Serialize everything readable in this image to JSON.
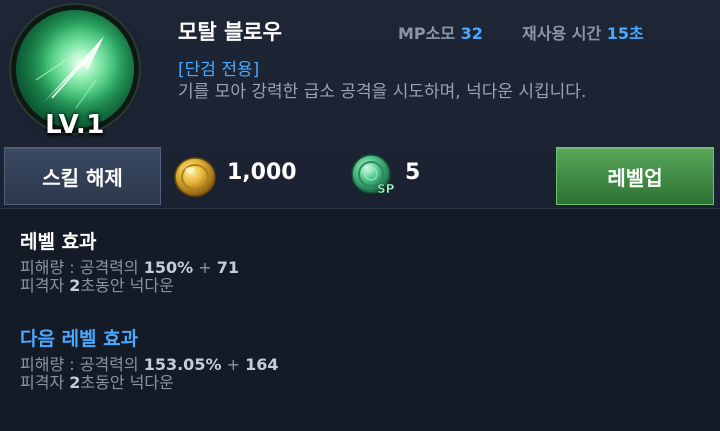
{
  "skill": {
    "name": "모탈 블로우",
    "level_label": "LV.1",
    "icon": "blade-slash-icon",
    "mp_label": "MP소모",
    "mp_value": "32",
    "cooldown_label": "재사용 시간",
    "cooldown_value": "15초",
    "tag": "[단검 전용]",
    "description": "기를 모아 강력한 급소 공격을 시도하며, 넉다운 시킵니다."
  },
  "actions": {
    "release_label": "스킬 해제",
    "gold_icon": "gold-coin-icon",
    "gold_amount": "1,000",
    "sp_icon": "sp-orb-icon",
    "sp_amount": "5",
    "levelup_label": "레벨업"
  },
  "current_effect": {
    "title": "레벨 효과",
    "damage_prefix": "피해량 : 공격력의 ",
    "damage_percent": "150%",
    "damage_plus": " + ",
    "damage_flat": "71",
    "kd_prefix": "피격자 ",
    "kd_value": "2",
    "kd_suffix": "초동안 넉다운"
  },
  "next_effect": {
    "title": "다음 레벨 효과",
    "damage_prefix": "피해량 : 공격력의 ",
    "damage_percent": "153.05%",
    "damage_plus": " + ",
    "damage_flat": "164",
    "kd_prefix": "피격자 ",
    "kd_value": "2",
    "kd_suffix": "초동안 넉다운"
  },
  "colors": {
    "accent_blue": "#4aa8ff",
    "levelup_green": "#4a9a4f",
    "background": "#1b2230"
  }
}
